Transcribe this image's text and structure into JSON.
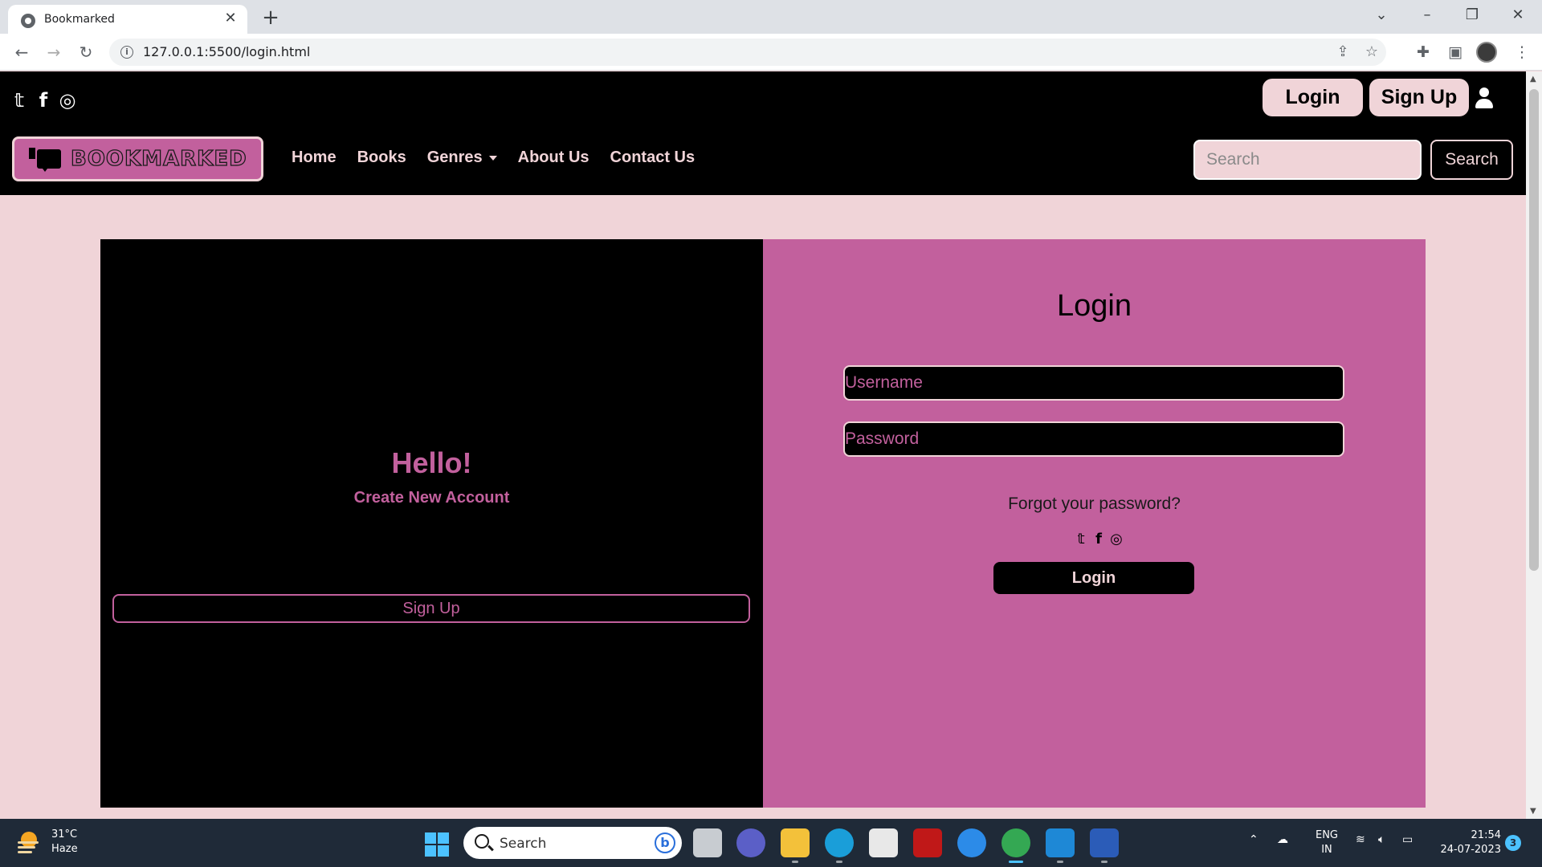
{
  "browser": {
    "tab_title": "Bookmarked",
    "url": "127.0.0.1:5500/login.html"
  },
  "header": {
    "login_label": "Login",
    "signup_label": "Sign Up",
    "brand": "BOOKMARKED",
    "nav": [
      "Home",
      "Books",
      "Genres",
      "About Us",
      "Contact Us"
    ],
    "search_placeholder": "Search",
    "search_button": "Search"
  },
  "left_panel": {
    "greeting": "Hello!",
    "subtitle": "Create New Account",
    "signup_button": "Sign Up"
  },
  "login_panel": {
    "title": "Login",
    "username_placeholder": "Username",
    "password_placeholder": "Password",
    "forgot": "Forgot your password?",
    "login_button": "Login"
  },
  "taskbar": {
    "temperature": "31°C",
    "condition": "Haze",
    "search_label": "Search",
    "lang_top": "ENG",
    "lang_bottom": "IN",
    "time": "21:54",
    "date": "24-07-2023",
    "notification_count": "3"
  },
  "colors": {
    "pink_light": "#f0d4d8",
    "pink_accent": "#c2609d",
    "black": "#000000"
  }
}
